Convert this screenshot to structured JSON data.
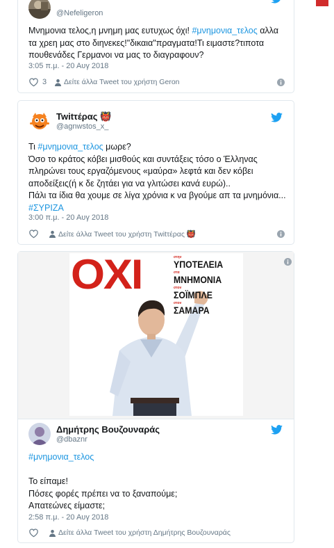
{
  "tweets": [
    {
      "name": "",
      "handle": "@Nefeligeron",
      "text_parts": [
        {
          "t": "Μνημονια τελος,η μνημη μας ευτυχως όχι! ",
          "h": false
        },
        {
          "t": "#μνημονια_τελος",
          "h": true
        },
        {
          "t": " αλλα τα χρεη μας στο διηνεκες!\"δικαια\"πραγματα!Τι ειμαστε?τιποτα πουθενάδες Γερμανοι να μας το διαγραφουν?",
          "h": false
        }
      ],
      "time": "3:05 π.μ. - 20 Αυγ 2018",
      "likes": "3",
      "more_link": "Δείτε άλλα Tweet του χρήστη Geron"
    },
    {
      "name": "Twitτέρας 👹",
      "handle": "@agnwstos_x_",
      "text_parts": [
        {
          "t": "Τι ",
          "h": false
        },
        {
          "t": "#μνημονια_τελος",
          "h": true
        },
        {
          "t": " μωρε?",
          "h": false
        },
        {
          "t": "\n",
          "h": false
        },
        {
          "t": "Όσο το κράτος κόβει μισθούς και συντάξεις τόσο ο Έλληνας πληρώνει τους εργαζόμενους «μαύρα» λεφτά και δεν κόβει αποδείξεις(ή κ δε ζητάει για να γλιτώσει κανά ευρώ)..",
          "h": false
        },
        {
          "t": "\n",
          "h": false
        },
        {
          "t": "Πάλι τα ίδια θα χουμε σε λίγα χρόνια κ να βγούμε απ τα μνημόνια...",
          "h": false
        },
        {
          "t": "\n",
          "h": false
        },
        {
          "t": "#ΣΥΡΙΖΑ",
          "h": true
        }
      ],
      "time": "3:00 π.μ. - 20 Αυγ 2018",
      "more_link": "Δείτε άλλα Tweet του χρήστη Twitτέρας 👹"
    },
    {
      "name": "Δημήτρης Βουζουναράς",
      "handle": "@dbaznr",
      "text_parts": [
        {
          "t": "#μνημονια_τελος",
          "h": true
        },
        {
          "t": "\n\n",
          "h": false
        },
        {
          "t": "Το είπαμε!",
          "h": false
        },
        {
          "t": "\n",
          "h": false
        },
        {
          "t": "Πόσες φορές πρέπει να το ξαναπούμε;",
          "h": false
        },
        {
          "t": "\n",
          "h": false
        },
        {
          "t": "Απατεώνες είμαστε;",
          "h": false
        }
      ],
      "time": "2:58 π.μ. - 20 Αυγ 2018",
      "more_link": "Δείτε άλλα Tweet του χρήστη Δημήτρης Βουζουναράς",
      "poster": {
        "big": "ΟΧΙ",
        "rows": [
          {
            "small": "στην",
            "word": "ΥΠΟΤΕΛΕΙΑ"
          },
          {
            "small": "στα",
            "word": "ΜΝΗΜΟΝΙΑ"
          },
          {
            "small": "στον",
            "word": "ΣΟΪΜΠΛΕ"
          },
          {
            "small": "στον",
            "word": "ΣΑΜΑΡΑ"
          }
        ]
      }
    }
  ],
  "colors": {
    "link": "#1b95e0",
    "muted": "#657786",
    "poster_red": "#d3221a",
    "heart": "#657786"
  }
}
